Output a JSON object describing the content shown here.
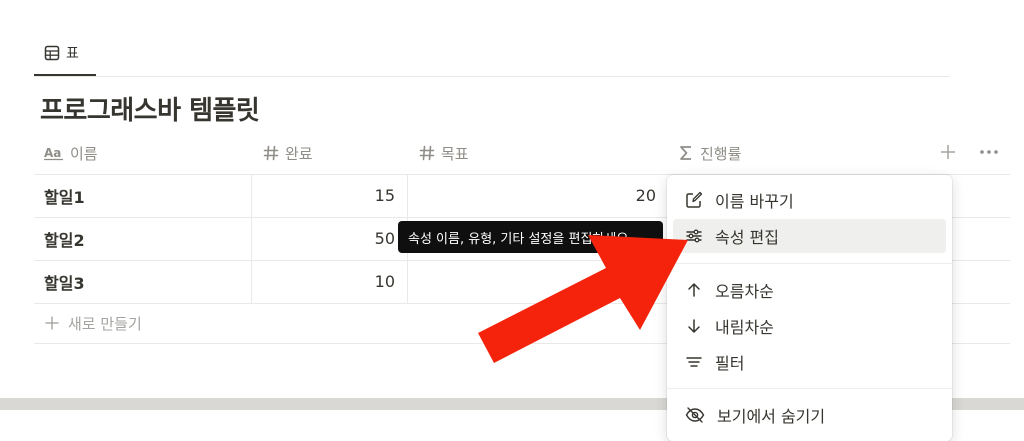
{
  "tab": {
    "label": "표",
    "icon": "table-icon"
  },
  "page_title": "프로그래스바 템플릿",
  "columns": [
    {
      "label": "이름",
      "icon": "text-aa-icon"
    },
    {
      "label": "완료",
      "icon": "hash-icon"
    },
    {
      "label": "목표",
      "icon": "hash-icon"
    },
    {
      "label": "진행률",
      "icon": "sigma-icon"
    }
  ],
  "rows": [
    {
      "name": "할일1",
      "done": "15",
      "goal": "20"
    },
    {
      "name": "할일2",
      "done": "50",
      "goal": ""
    },
    {
      "name": "할일3",
      "done": "10",
      "goal": ""
    }
  ],
  "new_row_label": "새로 만들기",
  "tooltip": "속성 이름, 유형, 기타 설정을 편집하세요",
  "menu": {
    "rename": "이름 바꾸기",
    "edit_property": "속성 편집",
    "sort_asc": "오름차순",
    "sort_desc": "내림차순",
    "filter": "필터",
    "hide_in_view": "보기에서 숨기기"
  },
  "colors": {
    "text": "#37352f",
    "muted": "#8f8d87",
    "border": "#e9e9e7",
    "tooltip_bg": "#0f0f0f",
    "arrow": "#f5230c",
    "menu_hover": "#efefee"
  }
}
